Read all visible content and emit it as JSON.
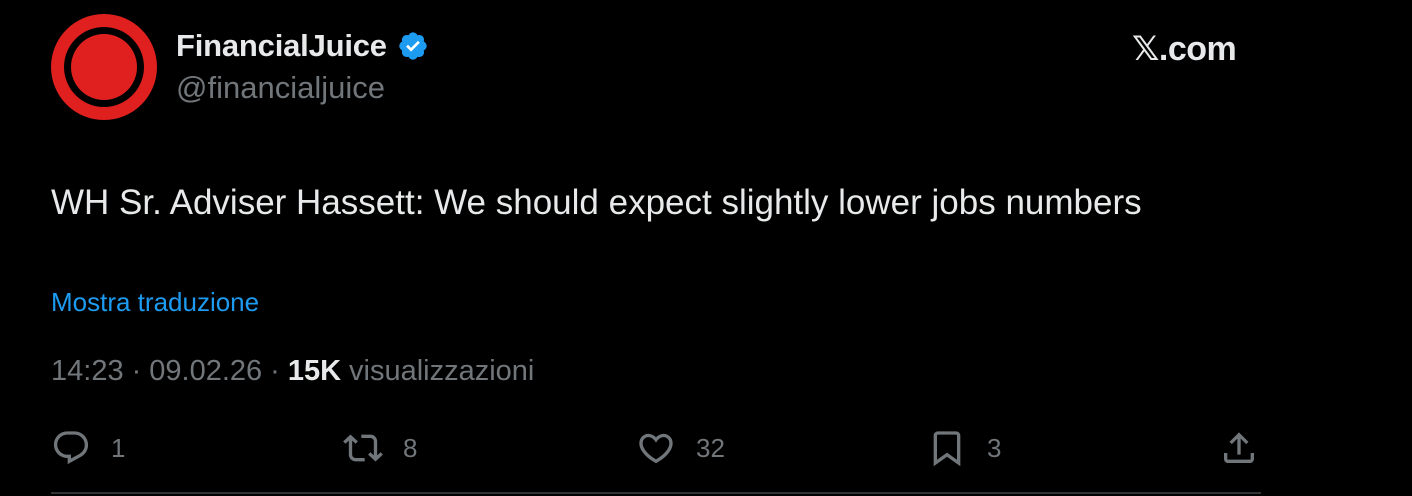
{
  "header": {
    "display_name": "FinancialJuice",
    "handle": "@financialjuice",
    "site": "𝕏.com",
    "site_x": "𝕏",
    "site_rest": ".com",
    "verified_icon": "verified-badge-icon",
    "avatar_icon": "red-circle-logo"
  },
  "tweet": {
    "text": "WH Sr. Adviser Hassett: We should expect slightly lower jobs numbers",
    "translate_label": "Mostra traduzione"
  },
  "meta": {
    "time": "14:23",
    "separator": "·",
    "date": "09.02.26",
    "views_count": "15K",
    "views_label": "visualizzazioni"
  },
  "actions": {
    "reply": {
      "icon": "reply-icon",
      "count": "1"
    },
    "repost": {
      "icon": "repost-icon",
      "count": "8"
    },
    "like": {
      "icon": "heart-icon",
      "count": "32"
    },
    "bookmark": {
      "icon": "bookmark-icon",
      "count": "3"
    },
    "share": {
      "icon": "share-icon"
    }
  },
  "colors": {
    "background": "#000000",
    "primary_text": "#e7e9ea",
    "secondary_text": "#71767b",
    "link": "#1d9bf0",
    "verified": "#1d9bf0",
    "avatar_red": "#e0201e"
  }
}
